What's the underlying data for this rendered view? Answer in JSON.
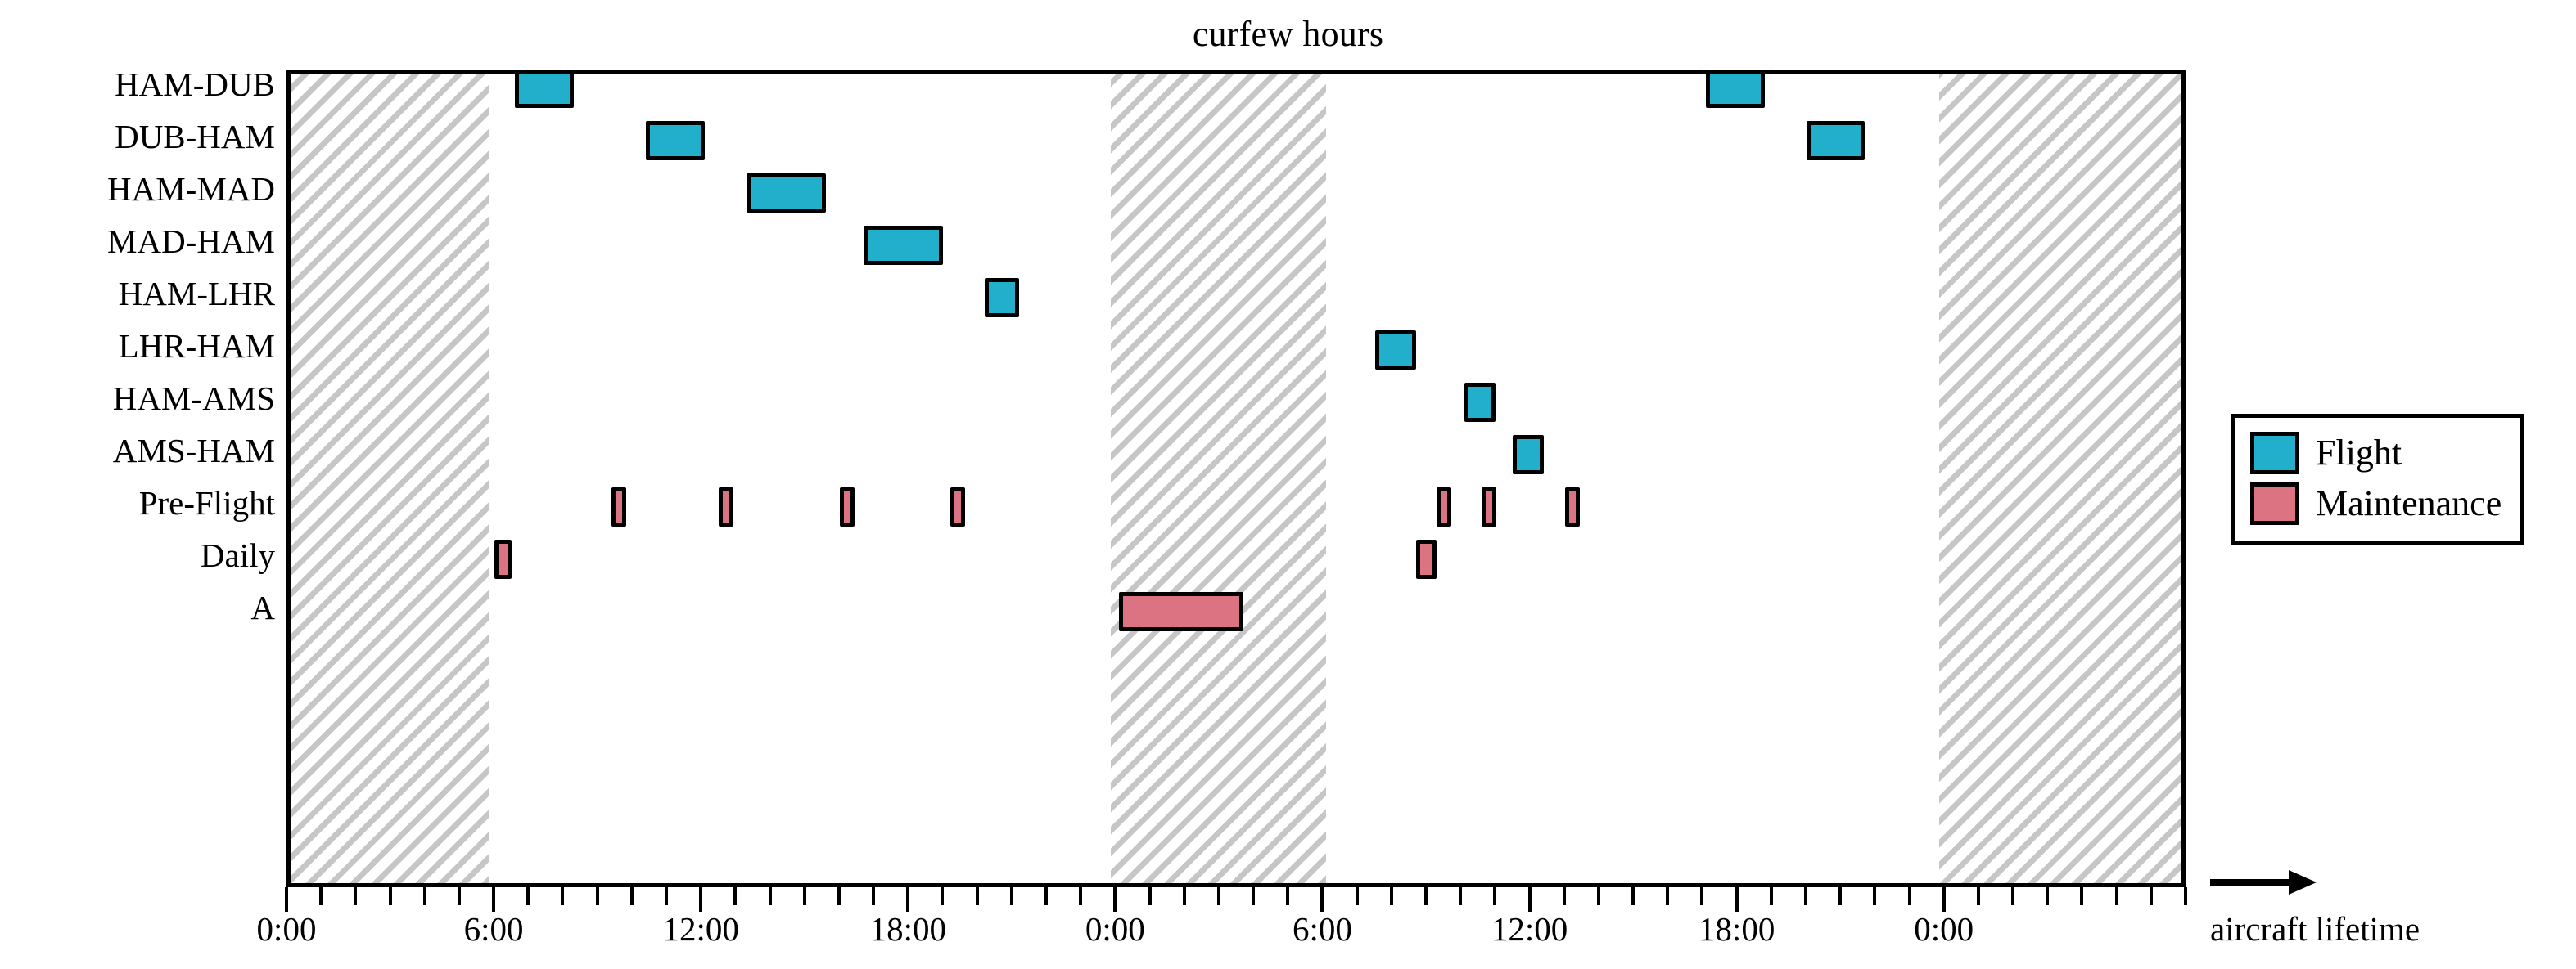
{
  "chart_data": {
    "type": "bar",
    "title": "curfew hours",
    "xlabel": "aircraft lifetime",
    "ylabel": "",
    "orientation": "horizontal-gantt",
    "x_axis": {
      "unit": "hours",
      "range_hours": [
        0,
        55
      ],
      "tick_interval_hours": 1,
      "labeled_ticks": [
        {
          "hour": 0,
          "label": "0:00"
        },
        {
          "hour": 6,
          "label": "6:00"
        },
        {
          "hour": 12,
          "label": "12:00"
        },
        {
          "hour": 18,
          "label": "18:00"
        },
        {
          "hour": 24,
          "label": "0:00"
        },
        {
          "hour": 30,
          "label": "6:00"
        },
        {
          "hour": 36,
          "label": "12:00"
        },
        {
          "hour": 42,
          "label": "18:00"
        },
        {
          "hour": 48,
          "label": "0:00"
        }
      ]
    },
    "categories": [
      "HAM-DUB",
      "DUB-HAM",
      "HAM-MAD",
      "MAD-HAM",
      "HAM-LHR",
      "LHR-HAM",
      "HAM-AMS",
      "AMS-HAM",
      "Pre-Flight",
      "Daily",
      "A"
    ],
    "grid": false,
    "legend": {
      "position": "right",
      "entries": [
        {
          "label": "Flight",
          "color": "#22AFCB"
        },
        {
          "label": "Maintenance",
          "color": "#DB7383"
        }
      ]
    },
    "shaded_regions": {
      "name": "curfew hours",
      "color": "#c6c6c6",
      "hatch": "diagonal",
      "intervals_hours": [
        [
          0,
          5.75
        ],
        [
          23.75,
          30.0
        ],
        [
          47.75,
          55.0
        ]
      ]
    },
    "tasks": [
      {
        "row": "HAM-DUB",
        "start_hour": 6.5,
        "end_hour": 8.2,
        "type": "Flight",
        "color": "#22AFCB"
      },
      {
        "row": "DUB-HAM",
        "start_hour": 10.3,
        "end_hour": 12.0,
        "type": "Flight",
        "color": "#22AFCB"
      },
      {
        "row": "HAM-MAD",
        "start_hour": 13.2,
        "end_hour": 15.5,
        "type": "Flight",
        "color": "#22AFCB"
      },
      {
        "row": "MAD-HAM",
        "start_hour": 16.6,
        "end_hour": 18.9,
        "type": "Flight",
        "color": "#22AFCB"
      },
      {
        "row": "HAM-LHR",
        "start_hour": 20.1,
        "end_hour": 21.1,
        "type": "Flight",
        "color": "#22AFCB"
      },
      {
        "row": "HAM-DUB",
        "start_hour": 41.0,
        "end_hour": 42.7,
        "type": "Flight",
        "color": "#22AFCB"
      },
      {
        "row": "DUB-HAM",
        "start_hour": 43.9,
        "end_hour": 45.6,
        "type": "Flight",
        "color": "#22AFCB"
      },
      {
        "row": "LHR-HAM",
        "start_hour": 31.4,
        "end_hour": 32.6,
        "type": "Flight",
        "color": "#22AFCB"
      },
      {
        "row": "HAM-AMS",
        "start_hour": 34.0,
        "end_hour": 34.9,
        "type": "Flight",
        "color": "#22AFCB"
      },
      {
        "row": "AMS-HAM",
        "start_hour": 35.4,
        "end_hour": 36.3,
        "type": "Flight",
        "color": "#22AFCB"
      },
      {
        "row": "Pre-Flight",
        "start_hour": 9.3,
        "end_hour": 9.7,
        "type": "Maintenance",
        "color": "#DB7383"
      },
      {
        "row": "Pre-Flight",
        "start_hour": 12.4,
        "end_hour": 12.8,
        "type": "Maintenance",
        "color": "#DB7383"
      },
      {
        "row": "Pre-Flight",
        "start_hour": 15.9,
        "end_hour": 16.3,
        "type": "Maintenance",
        "color": "#DB7383"
      },
      {
        "row": "Pre-Flight",
        "start_hour": 19.1,
        "end_hour": 19.5,
        "type": "Maintenance",
        "color": "#DB7383"
      },
      {
        "row": "Pre-Flight",
        "start_hour": 33.2,
        "end_hour": 33.6,
        "type": "Maintenance",
        "color": "#DB7383"
      },
      {
        "row": "Pre-Flight",
        "start_hour": 34.5,
        "end_hour": 34.9,
        "type": "Maintenance",
        "color": "#DB7383"
      },
      {
        "row": "Pre-Flight",
        "start_hour": 36.9,
        "end_hour": 37.3,
        "type": "Maintenance",
        "color": "#DB7383"
      },
      {
        "row": "Daily",
        "start_hour": 5.9,
        "end_hour": 6.4,
        "type": "Maintenance",
        "color": "#DB7383"
      },
      {
        "row": "Daily",
        "start_hour": 32.6,
        "end_hour": 33.2,
        "type": "Maintenance",
        "color": "#DB7383"
      },
      {
        "row": "A",
        "start_hour": 24.0,
        "end_hour": 27.6,
        "type": "Maintenance",
        "color": "#DB7383"
      }
    ]
  },
  "legend": {
    "flight_label": "Flight",
    "maintenance_label": "Maintenance"
  },
  "axis": {
    "title": "curfew hours",
    "lifetime_label": "aircraft lifetime"
  }
}
